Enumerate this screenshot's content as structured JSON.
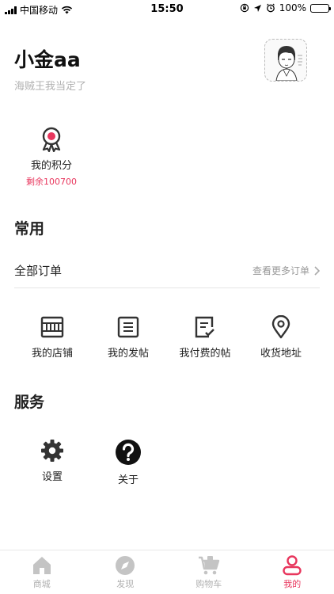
{
  "status_bar": {
    "carrier": "中国移动",
    "time": "15:50",
    "battery": "100%"
  },
  "profile": {
    "name": "小金aa",
    "signature": "海贼王我当定了"
  },
  "points": {
    "title": "我的积分",
    "value": "剩余100700"
  },
  "common": {
    "title": "常用",
    "orders_label": "全部订单",
    "orders_more": "查看更多订单",
    "items": [
      {
        "label": "我的店铺",
        "icon": "shop-icon"
      },
      {
        "label": "我的发帖",
        "icon": "post-icon"
      },
      {
        "label": "我付费的帖",
        "icon": "paid-post-icon"
      },
      {
        "label": "收货地址",
        "icon": "location-pin-icon"
      }
    ]
  },
  "services": {
    "title": "服务",
    "items": [
      {
        "label": "设置",
        "icon": "gear-icon"
      },
      {
        "label": "关于",
        "icon": "question-icon"
      }
    ]
  },
  "tabbar": {
    "active_color": "#e8365d",
    "inactive_color": "#b0b0b0",
    "tabs": [
      {
        "label": "商城",
        "icon": "home-icon"
      },
      {
        "label": "发现",
        "icon": "compass-icon"
      },
      {
        "label": "购物车",
        "icon": "cart-icon"
      },
      {
        "label": "我的",
        "icon": "user-icon",
        "active": true
      }
    ]
  }
}
